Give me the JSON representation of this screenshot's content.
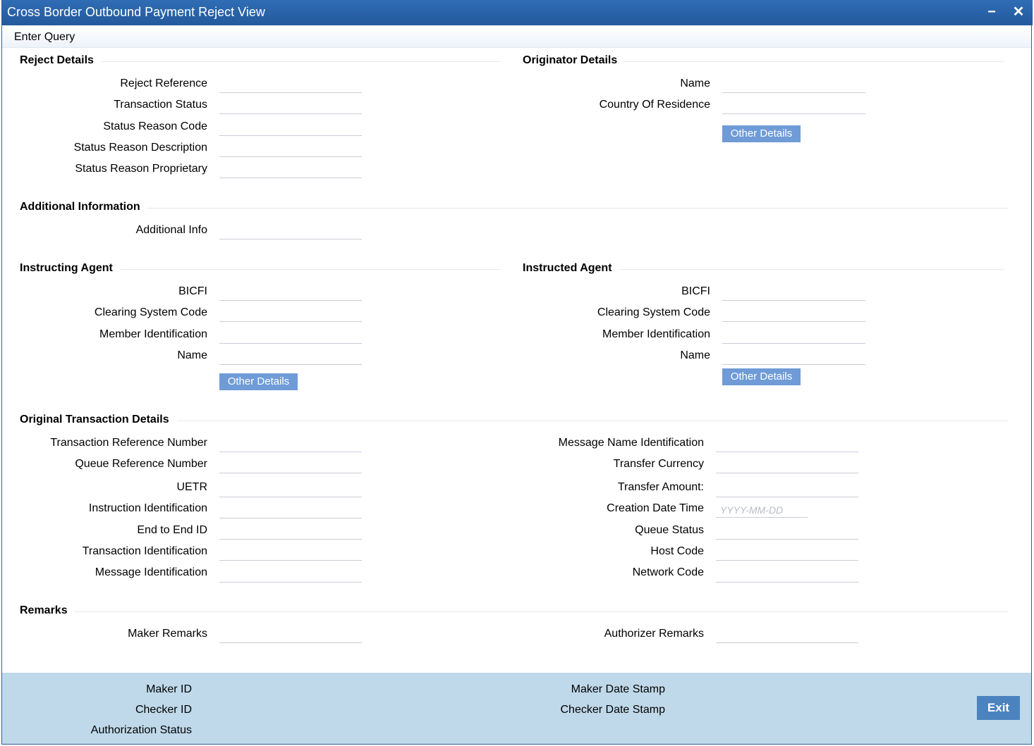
{
  "window": {
    "title": "Cross Border Outbound Payment Reject View",
    "minimize_symbol": "−",
    "close_symbol": "✕"
  },
  "toolbar": {
    "enter_query": "Enter Query"
  },
  "reject_details": {
    "title": "Reject Details",
    "reject_reference": "Reject Reference",
    "transaction_status": "Transaction Status",
    "status_reason_code": "Status Reason Code",
    "status_reason_description": "Status Reason Description",
    "status_reason_proprietary": "Status Reason Proprietary"
  },
  "originator_details": {
    "title": "Originator Details",
    "name": "Name",
    "country_of_residence": "Country Of Residence",
    "other_details": "Other Details"
  },
  "additional_information": {
    "title": "Additional Information",
    "additional_info": "Additional Info"
  },
  "instructing_agent": {
    "title": "Instructing Agent",
    "bicfi": "BICFI",
    "clearing_system_code": "Clearing System Code",
    "member_identification": "Member Identification",
    "name": "Name",
    "other_details": "Other Details"
  },
  "instructed_agent": {
    "title": "Instructed Agent",
    "bicfi": "BICFI",
    "clearing_system_code": "Clearing System Code",
    "member_identification": "Member Identification",
    "name": "Name",
    "other_details": "Other Details"
  },
  "original_transaction": {
    "title": "Original Transaction Details",
    "transaction_reference_number": "Transaction Reference Number",
    "queue_reference_number": "Queue Reference Number",
    "uetr": "UETR",
    "instruction_identification": "Instruction Identification",
    "end_to_end_id": "End to End ID",
    "transaction_identification": "Transaction Identification",
    "message_identification": "Message Identification",
    "message_name_identification": "Message Name Identification",
    "transfer_currency": "Transfer Currency",
    "transfer_amount": "Transfer Amount:",
    "creation_date_time": "Creation Date Time",
    "creation_date_placeholder": "YYYY-MM-DD",
    "queue_status": "Queue Status",
    "host_code": "Host Code",
    "network_code": "Network Code"
  },
  "remarks": {
    "title": "Remarks",
    "maker_remarks": "Maker Remarks",
    "authorizer_remarks": "Authorizer Remarks"
  },
  "footer": {
    "maker_id": "Maker ID",
    "checker_id": "Checker ID",
    "authorization_status": "Authorization Status",
    "maker_date_stamp": "Maker Date Stamp",
    "checker_date_stamp": "Checker Date Stamp",
    "exit": "Exit"
  },
  "colors": {
    "titlebar": "#24599c",
    "button": "#6f9bd7",
    "footer": "#bfd9ea",
    "exit_button": "#4b83bf"
  }
}
